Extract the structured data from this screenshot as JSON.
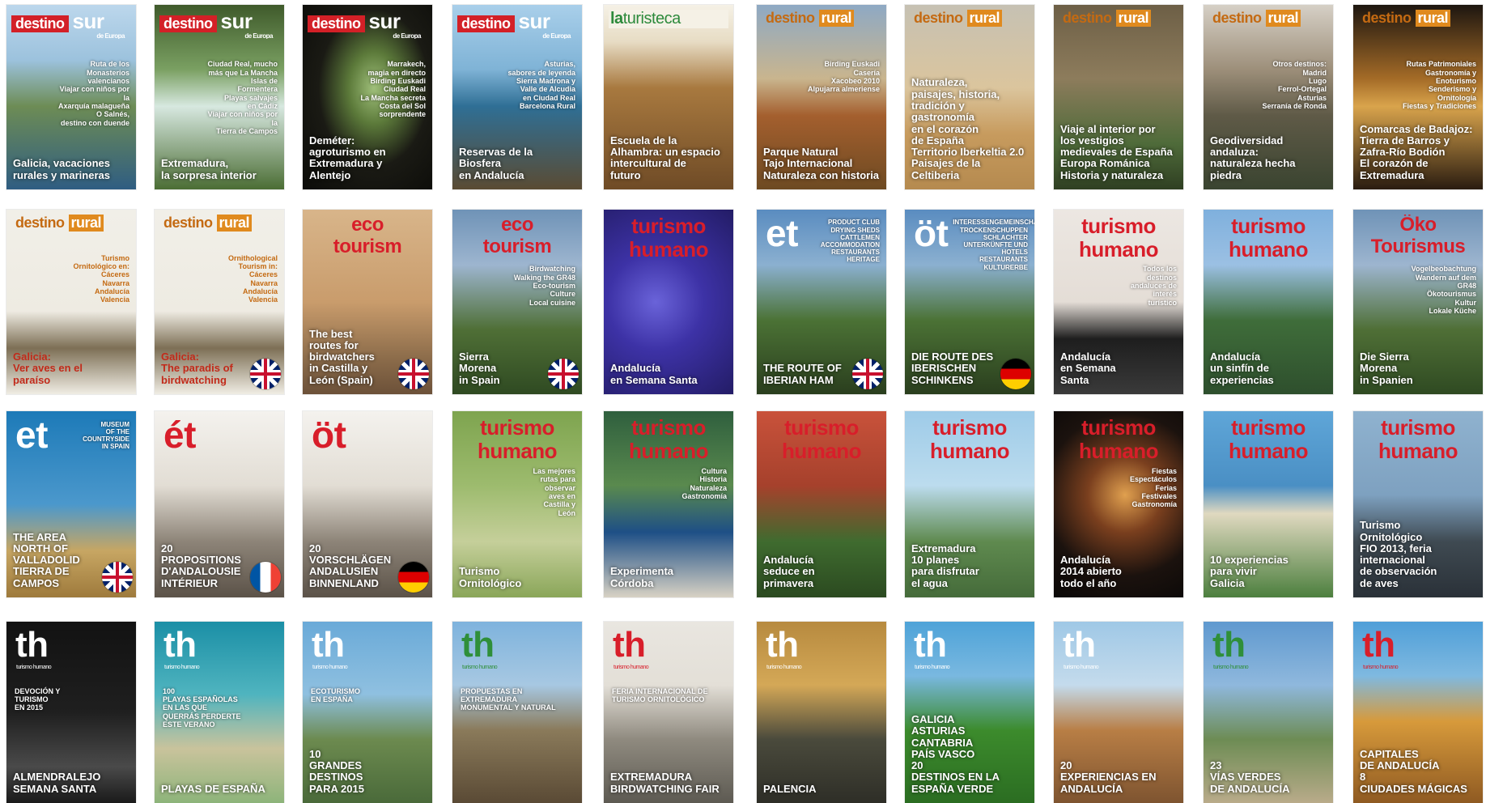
{
  "covers": [
    {
      "mast1": "destino",
      "mast2": "sur",
      "mast3": "de Europa",
      "sub": "Ruta de los\nMonasterios valencianos\nViajar con niños por la\nAxarquía malagueña\nO Salnés,\ndestino con duende",
      "headline": "Galicia, vacaciones\nrurales y marineras",
      "flag": "",
      "style": "sur",
      "bg": "linear-gradient(#bcd7ec 0%,#9cc2dd 30%,#6d8c55 55%,#2f5d82 100%)"
    },
    {
      "mast1": "destino",
      "mast2": "sur",
      "mast3": "de Europa",
      "sub": "Ciudad Real, mucho\nmás que La Mancha\nIslas de\nFormentera\nPlayas salvajes\nen Cádiz\nViajar con niños por la\nTierra de Campos",
      "headline": "Extremadura,\nla sorpresa interior",
      "flag": "",
      "style": "sur",
      "bg": "linear-gradient(#3f5a2b 0%,#7aa062 35%,#d7e8e0 55%,#4b6d34 100%)"
    },
    {
      "mast1": "destino",
      "mast2": "sur",
      "mast3": "de Europa",
      "sub": "Marrakech,\nmagia en directo\nBirding Euskadi\nCiudad Real\nLa Mancha secreta\nCosta del Sol\nsorprendente",
      "headline": "Deméter:\nagroturismo en\nExtremadura y Alentejo",
      "flag": "",
      "style": "sur",
      "bg": "radial-gradient(ellipse at 55% 45%,#9fbf7a 0%,#5c7a3a 25%,#1a1a14 55%,#0b0b08 100%)"
    },
    {
      "mast1": "destino",
      "mast2": "sur",
      "mast3": "de Europa",
      "sub": "Asturias,\nsabores de leyenda\nSierra Madrona y\nValle de Alcudia\nen Ciudad Real\nBarcelona Rural",
      "headline": "Reservas de la Biosfera\nen Andalucía",
      "flag": "",
      "style": "sur",
      "bg": "linear-gradient(#a9cfea 0%,#7fb3d6 35%,#2f6f95 55%,#5a4b33 100%)"
    },
    {
      "mast1": "la",
      "mast2": "turisteca",
      "mast3": "",
      "sub": "",
      "headline": "Escuela de la\nAlhambra: un espacio\nintercultural de\nfuturo",
      "flag": "",
      "style": "turisteca",
      "bg": "linear-gradient(#f5f1e6 0%,#e7dcc4 20%,#a8793f 45%,#6f4b26 100%)"
    },
    {
      "mast1": "destino",
      "mast2": "rural",
      "mast3": "",
      "sub": "Birding Euskadi\nCasería\nXacobeo 2010\nAlpujarra almeriense",
      "headline": "Parque Natural\nTajo Internacional\nNaturaleza con historia",
      "flag": "",
      "style": "rural",
      "bg": "linear-gradient(#8ea9c4 0%,#c9b58e 40%,#a45f2e 60%,#6d4a22 100%)"
    },
    {
      "mast1": "destino",
      "mast2": "rural",
      "mast3": "",
      "sub": "",
      "headline": "Naturaleza,\npaisajes, historia,\ntradición y\ngastronomía\nen el corazón\nde España\nTerritorio Iberkeltia 2.0\nPaisajes de la Celtiberia",
      "flag": "",
      "style": "rural",
      "bg": "linear-gradient(#c6c1b3 0%,#dbc59d 45%,#c79b5e 70%,#b58a4f 100%)"
    },
    {
      "mast1": "destino",
      "mast2": "rural",
      "mast3": "",
      "sub": "",
      "headline": "Viaje al interior por\nlos vestigios\nmedievales de España\nEuropa Románica\nHistoria y naturaleza",
      "flag": "",
      "style": "rural",
      "bg": "linear-gradient(#6d5f46 0%,#8d7c5c 40%,#4f6b3a 75%,#2f3f22 100%)"
    },
    {
      "mast1": "destino",
      "mast2": "rural",
      "mast3": "",
      "sub": "Otros destinos:\nMadrid\nLugo\nFerrol-Ortegal\nAsturias\nSerranía de Ronda",
      "headline": "Geodiversidad\nandaluza:\nnaturaleza hecha piedra",
      "flag": "",
      "style": "rural",
      "bg": "linear-gradient(#d6d0c6 0%,#9d8f7a 35%,#5f5a47 60%,#3a4430 100%)"
    },
    {
      "mast1": "destino",
      "mast2": "rural",
      "mast3": "",
      "sub": "Rutas Patrimoniales\nGastronomía y Enoturismo\nSenderismo y Ornitología\nFiestas y Tradiciones",
      "headline": "Comarcas de Badajoz:\nTierra de Barros y\nZafra-Río Bodión\nEl corazón de Extremadura",
      "flag": "",
      "style": "rural",
      "bg": "linear-gradient(#1d1610 0%,#a46b27 40%,#d9a44c 55%,#2a1c10 100%)"
    },
    {
      "mast1": "destino",
      "mast2": "rural",
      "mast3": "",
      "sub": "Turismo\nOrnitológico en:\nCáceres\nNavarra\nAndalucía\nValencia",
      "headline": "Galicia:\nVer aves en el\nparaíso",
      "flag": "",
      "style": "rural-light",
      "bg": "linear-gradient(#f1efe8 0%,#eeebe2 55%,#7d6f55 75%,#f0ede4 100%)"
    },
    {
      "mast1": "destino",
      "mast2": "rural",
      "mast3": "",
      "sub": "Ornithological\nTourism in:\nCáceres\nNavarra\nAndalucía\nValencia",
      "headline": "Galicia:\nThe paradis of\nbirdwatching",
      "flag": "uk",
      "style": "rural-light",
      "bg": "linear-gradient(#f1efe8 0%,#eeebe2 55%,#7d6f55 75%,#f0ede4 100%)"
    },
    {
      "mast1": "eco",
      "mast2": "tourism",
      "mast3": "",
      "sub": "",
      "headline": "The best\nroutes for\nbirdwatchers\nin Castilla y\nLeón (Spain)",
      "flag": "uk",
      "style": "eco",
      "bg": "linear-gradient(#d8b58a 0%,#c99c6c 50%,#8d6d4b 80%,#6c5139 100%)"
    },
    {
      "mast1": "eco",
      "mast2": "tourism",
      "mast3": "",
      "sub": "Birdwatching\nWalking the GR48\nEco-tourism\nCulture\nLocal cuisine",
      "headline": "Sierra\nMorena\nin Spain",
      "flag": "uk",
      "style": "eco",
      "bg": "linear-gradient(#6f93b7 0%,#9db5cf 30%,#4f6f36 65%,#2f4a22 100%)"
    },
    {
      "mast1": "turismo",
      "mast2": "humano",
      "mast3": "",
      "sub": "",
      "headline": "Andalucía\nen Semana Santa",
      "flag": "",
      "style": "th-red",
      "bg": "radial-gradient(circle at 40% 50%,#6a63d9 0%,#3d32a6 40%,#231c66 100%)"
    },
    {
      "mast1": "et",
      "mast2": "",
      "mast3": "",
      "sub": "PRODUCT CLUB\nDRYING SHEDS\nCATTLEMEN\nACCOMMODATION\nRESTAURANTS\nHERITAGE",
      "headline": "THE ROUTE OF\nIBERIAN HAM",
      "flag": "uk",
      "style": "et",
      "bg": "linear-gradient(#5a8cc0 0%,#8bb0d0 30%,#4b7235 60%,#2a3e1e 100%)"
    },
    {
      "mast1": "öt",
      "mast2": "",
      "mast3": "",
      "sub": "INTERESSENGEMEINSCHAFT\nTROCKENSCHUPPEN\nSCHLACHTER\nUNTERKÜNFTE UND HOTELS\nRESTAURANTS\nKULTURERBE",
      "headline": "DIE ROUTE DES\nIBERISCHEN\nSCHINKENS",
      "flag": "de",
      "style": "et",
      "bg": "linear-gradient(#5a8cc0 0%,#8bb0d0 30%,#4b7235 60%,#2a3e1e 100%)"
    },
    {
      "mast1": "turismo",
      "mast2": "humano",
      "mast3": "",
      "sub": "Todos los\ndestinos\nandaluces de\ninterés\nturístico",
      "headline": "Andalucía\nen Semana\nSanta",
      "flag": "",
      "style": "th-red",
      "bg": "linear-gradient(#ece7e2 0%,#e4ddd6 50%,#1e1e1e 70%,#3a3a3a 100%)"
    },
    {
      "mast1": "turismo",
      "mast2": "humano",
      "mast3": "",
      "sub": "",
      "headline": "Andalucía\nun sinfín de\nexperiencias",
      "flag": "",
      "style": "th-red",
      "bg": "linear-gradient(#7fb0dd 0%,#9bc0e3 30%,#3f6d3a 60%,#2e4f2d 100%)"
    },
    {
      "mast1": "Öko",
      "mast2": "Tourismus",
      "mast3": "",
      "sub": "Vogelbeobachtung\nWandern auf dem GR48\nÖkotourismus\nKultur\nLokale Küche",
      "headline": "Die Sierra\nMorena\nin Spanien",
      "flag": "",
      "style": "eco",
      "bg": "linear-gradient(#6f93b7 0%,#9db5cf 30%,#4f6f36 65%,#2f4a22 100%)"
    },
    {
      "mast1": "et",
      "mast2": "",
      "mast3": "",
      "sub": "MUSEUM\nOF THE\nCOUNTRYSIDE\nIN SPAIN",
      "headline": "THE AREA NORTH OF\nVALLADOLID\nTIERRA DE CAMPOS",
      "flag": "uk",
      "style": "et-blue",
      "bg": "linear-gradient(#1d7ab8 0%,#4b98cc 50%,#c7a663 75%,#9e7a3c 100%)"
    },
    {
      "mast1": "ét",
      "mast2": "",
      "mast3": "",
      "sub": "",
      "headline": "20\nPROPOSITIONS\nD'ANDALOUSIE\nINTÉRIEUR",
      "flag": "fr",
      "style": "et-red",
      "bg": "linear-gradient(#f4f2ee 0%,#e2ddd4 40%,#8d8478 70%,#5b5248 100%)"
    },
    {
      "mast1": "öt",
      "mast2": "",
      "mast3": "",
      "sub": "",
      "headline": "20\nVORSCHLÄGEN\nANDALUSIEN\nBINNENLAND",
      "flag": "de",
      "style": "et-red",
      "bg": "linear-gradient(#f4f2ee 0%,#e2ddd4 40%,#8d8478 70%,#5b5248 100%)"
    },
    {
      "mast1": "turismo",
      "mast2": "humano",
      "mast3": "",
      "sub": "Las mejores\nrutas para\nobservar\naves en\nCastilla y\nLeón",
      "headline": "Turismo\nOrnitológico",
      "flag": "",
      "style": "th-red",
      "bg": "linear-gradient(#7ea44f 0%,#9dbb6e 40%,#c5cf9a 70%,#8aa659 100%)"
    },
    {
      "mast1": "turismo",
      "mast2": "humano",
      "mast3": "",
      "sub": "Cultura\nHistoria\nNaturaleza\nGastronomía",
      "headline": "Experimenta\nCórdoba",
      "flag": "",
      "style": "th-red",
      "bg": "linear-gradient(#2f5f3e 0%,#5a8a4e 40%,#1e4f86 65%,#d8d2c4 100%)"
    },
    {
      "mast1": "turismo",
      "mast2": "humano",
      "mast3": "",
      "sub": "",
      "headline": "Andalucía\nseduce en\nprimavera",
      "flag": "",
      "style": "th-red",
      "bg": "linear-gradient(#c9523b 0%,#a6412c 40%,#3f6b2f 70%,#2b4a20 100%)"
    },
    {
      "mast1": "turismo",
      "mast2": "humano",
      "mast3": "",
      "sub": "",
      "headline": "Extremadura\n10 planes\npara disfrutar\nel agua",
      "flag": "",
      "style": "th-red",
      "bg": "linear-gradient(#9ecbe8 0%,#bcdcee 40%,#5f8a4f 70%,#456b3a 100%)"
    },
    {
      "mast1": "turismo",
      "mast2": "humano",
      "mast3": "",
      "sub": "Fiestas\nEspectáculos\nFerias\nFestivales\nGastronomía",
      "headline": "Andalucía\n2014 abierto\ntodo el año",
      "flag": "",
      "style": "th-red",
      "bg": "radial-gradient(circle at 55% 45%,#e0a04f 0%,#7a3f1e 30%,#1b120e 65%,#0a0807 100%)"
    },
    {
      "mast1": "turismo",
      "mast2": "humano",
      "mast3": "",
      "sub": "",
      "headline": "10 experiencias\npara vivir\nGalicia",
      "flag": "",
      "style": "th-red",
      "bg": "linear-gradient(#5fa6d8 0%,#4a8fc4 40%,#e0d9c0 55%,#4c7f3e 100%)"
    },
    {
      "mast1": "turismo",
      "mast2": "humano",
      "mast3": "",
      "sub": "",
      "headline": "Turismo\nOrnitológico\nFIO 2013, feria\ninternacional\nde observación\nde aves",
      "flag": "",
      "style": "th-red",
      "bg": "linear-gradient(#8fb2cf 0%,#7ea1c0 45%,#3f4a52 70%,#2a3138 100%)"
    },
    {
      "mast1": "th",
      "mast2": "turismo humano",
      "mast3": "",
      "sub": "DEVOCIÓN Y\nTURISMO\nEN 2015",
      "headline": "ALMENDRALEJO\nSEMANA SANTA",
      "flag": "",
      "style": "th-white",
      "bg": "linear-gradient(#121212 0%,#1f1f1f 50%,#4a4a4a 80%,#1a1a1a 100%)"
    },
    {
      "mast1": "th",
      "mast2": "turismo humano",
      "mast3": "",
      "sub": "100\nPLAYAS ESPAÑOLAS\nEN LAS QUE\nQUERRÁS PERDERTE\nESTE VERANO",
      "headline": "PLAYAS DE ESPAÑA",
      "flag": "",
      "style": "th-white",
      "bg": "linear-gradient(#1b8fa6 0%,#4fb4bf 40%,#c9c39c 70%,#8db47a 100%)"
    },
    {
      "mast1": "th",
      "mast2": "turismo humano",
      "mast3": "",
      "sub": "ECOTURISMO\nEN ESPAÑA",
      "headline": "10\nGRANDES\nDESTINOS\nPARA 2015",
      "flag": "",
      "style": "th-white",
      "bg": "linear-gradient(#6aaad8 0%,#8fc0e0 40%,#6c8a4f 65%,#4a6a3a 100%)"
    },
    {
      "mast1": "th",
      "mast2": "turismo humano",
      "mast3": "",
      "sub": "PROPUESTAS EN\nEXTREMADURA\nMONUMENTAL Y NATURAL",
      "headline": "",
      "flag": "",
      "style": "th-green",
      "bg": "linear-gradient(#7eb3dd 0%,#a7c8e2 35%,#8a7a5a 60%,#5a4a35 100%)"
    },
    {
      "mast1": "th",
      "mast2": "turismo humano",
      "mast3": "",
      "sub": "FERIA INTERNACIONAL DE\nTURISMO ORNITOLÓGICO",
      "headline": "EXTREMADURA\nBIRDWATCHING FAIR",
      "flag": "",
      "style": "th-red-logo",
      "bg": "linear-gradient(#e9e6e0 0%,#e3dfd7 35%,#8f8a7f 65%,#5d5a52 100%)"
    },
    {
      "mast1": "th",
      "mast2": "turismo humano",
      "mast3": "",
      "sub": "",
      "headline": "PALENCIA",
      "flag": "",
      "style": "th-white",
      "bg": "linear-gradient(#b78a3f 0%,#d4a857 35%,#4a4a3c 65%,#2e2e27 100%)"
    },
    {
      "mast1": "th",
      "mast2": "turismo humano",
      "mast3": "",
      "sub": "",
      "headline": "GALICIA\nASTURIAS\nCANTABRIA\nPAÍS VASCO\n20\nDESTINOS EN LA\nESPAÑA VERDE",
      "flag": "",
      "style": "th-white",
      "bg": "linear-gradient(#4ea3d8 0%,#79b8e0 30%,#3c8b2c 60%,#2b6d22 100%)"
    },
    {
      "mast1": "th",
      "mast2": "turismo humano",
      "mast3": "",
      "sub": "",
      "headline": "20\nEXPERIENCIAS EN\nANDALUCÍA",
      "flag": "",
      "style": "th-white",
      "bg": "linear-gradient(#9fc8e6 0%,#c4dbec 35%,#b87e45 60%,#7e5430 100%)"
    },
    {
      "mast1": "th",
      "mast2": "turismo humano",
      "mast3": "",
      "sub": "",
      "headline": "23\nVÍAS VERDES\nDE ANDALUCÍA",
      "flag": "",
      "style": "th-green",
      "bg": "linear-gradient(#5f99cf 0%,#8fb8dd 35%,#6d8c54 65%,#b9ab8a 100%)"
    },
    {
      "mast1": "th",
      "mast2": "turismo humano",
      "mast3": "",
      "sub": "",
      "headline": "CAPITALES\nDE ANDALUCÍA\n8\nCIUDADES MÁGICAS",
      "flag": "",
      "style": "th-red-logo",
      "bg": "linear-gradient(#4f9fd8 0%,#7fb9e0 30%,#d79a3b 55%,#8f5a22 100%)"
    }
  ]
}
